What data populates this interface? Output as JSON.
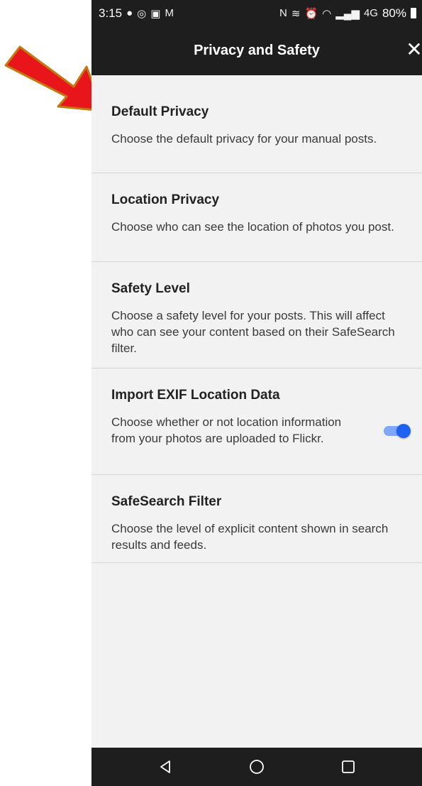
{
  "status_bar": {
    "time": "3:15",
    "left_icons": [
      "chat-bubble-icon",
      "instagram-icon",
      "video-icon",
      "gmail-icon"
    ],
    "right_icons": [
      "nfc-icon",
      "vibrate-icon",
      "alarm-icon",
      "wifi-icon",
      "signal-icon"
    ],
    "network": "4G",
    "battery": "80%"
  },
  "header": {
    "title": "Privacy and Safety",
    "close_symbol": "✕",
    "background_color": "#1e1e1e"
  },
  "settings": {
    "items": [
      {
        "title": "Default Privacy",
        "description": "Choose the default privacy for your manual posts."
      },
      {
        "title": "Location Privacy",
        "description": "Choose who can see the location of photos you post."
      },
      {
        "title": "Safety Level",
        "description": "Choose a safety level for your posts. This will affect who can see your content based on their SafeSearch filter."
      },
      {
        "title": "Import EXIF Location Data",
        "description": "Choose whether or not location information from your photos are uploaded to Flickr.",
        "toggle_on": true
      },
      {
        "title": "SafeSearch Filter",
        "description": "Choose the level of explicit content shown in search results and feeds."
      }
    ]
  },
  "nav_bar": {
    "buttons": [
      "back-triangle-icon",
      "home-circle-icon",
      "recents-square-icon"
    ]
  },
  "colors": {
    "accent_toggle": "#1d62f0",
    "annotation_arrow": "#e8161b",
    "annotation_arrow_outline": "#c07a10"
  }
}
